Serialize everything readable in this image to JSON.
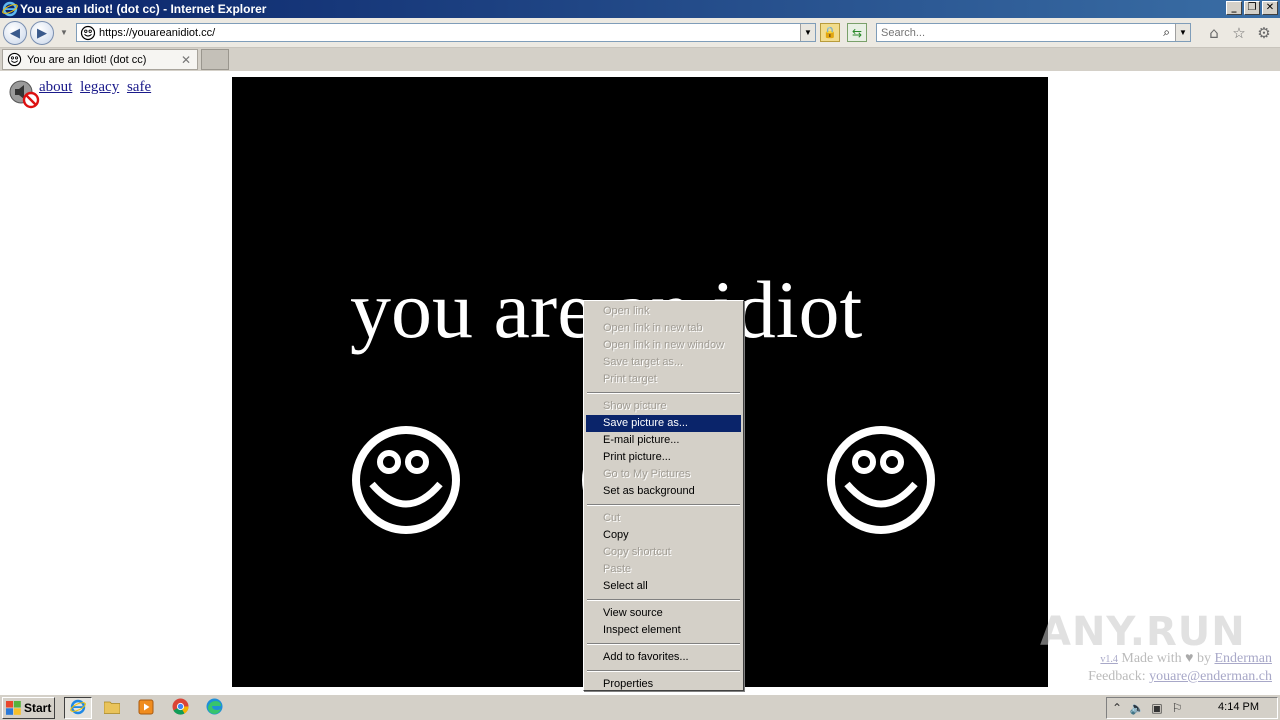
{
  "window": {
    "title": "You are an Idiot! (dot cc) - Internet Explorer",
    "controls": [
      "_",
      "❐",
      "✕"
    ]
  },
  "nav": {
    "url": "https://youareanidiot.cc/",
    "search_placeholder": "Search..."
  },
  "tab": {
    "label": "You are an Idiot! (dot cc)"
  },
  "page": {
    "links": [
      "about",
      "legacy",
      "safe"
    ],
    "headline": "you are an idiot",
    "footer": {
      "version": "v1.4",
      "made_with": "Made with",
      "by": "by",
      "author": "Enderman",
      "feedback_label": "Feedback:",
      "feedback_email": "youare@enderman.ch"
    },
    "watermark": "ANY.RUN"
  },
  "context_menu": {
    "groups": [
      [
        {
          "label": "Open link",
          "enabled": false
        },
        {
          "label": "Open link in new tab",
          "enabled": false
        },
        {
          "label": "Open link in new window",
          "enabled": false
        },
        {
          "label": "Save target as...",
          "enabled": false
        },
        {
          "label": "Print target",
          "enabled": false
        }
      ],
      [
        {
          "label": "Show picture",
          "enabled": false
        },
        {
          "label": "Save picture as...",
          "enabled": true,
          "highlighted": true
        },
        {
          "label": "E-mail picture...",
          "enabled": true
        },
        {
          "label": "Print picture...",
          "enabled": true
        },
        {
          "label": "Go to My Pictures",
          "enabled": false
        },
        {
          "label": "Set as background",
          "enabled": true
        }
      ],
      [
        {
          "label": "Cut",
          "enabled": false
        },
        {
          "label": "Copy",
          "enabled": true
        },
        {
          "label": "Copy shortcut",
          "enabled": false
        },
        {
          "label": "Paste",
          "enabled": false
        },
        {
          "label": "Select all",
          "enabled": true
        }
      ],
      [
        {
          "label": "View source",
          "enabled": true
        },
        {
          "label": "Inspect element",
          "enabled": true
        }
      ],
      [
        {
          "label": "Add to favorites...",
          "enabled": true
        }
      ],
      [
        {
          "label": "Properties",
          "enabled": true
        }
      ]
    ]
  },
  "taskbar": {
    "start_label": "Start",
    "clock": "4:14 PM"
  },
  "colors": {
    "titlebar_start": "#0a246a",
    "titlebar_end": "#3a6ea5",
    "menu_highlight": "#0a246a",
    "stage_bg": "#000000"
  }
}
